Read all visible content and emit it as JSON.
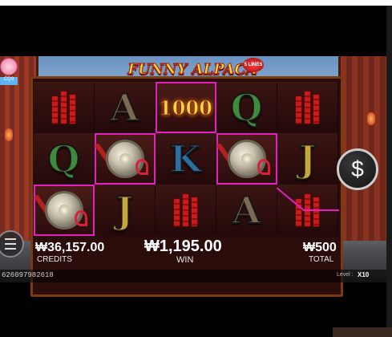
{
  "game": {
    "title": "FUNNY ALPACA",
    "lines_badge": "5 LINES",
    "logo_tag": "CQ9",
    "colors": {
      "win_highlight": "#e21fbf",
      "letter_A": "#7a6a54",
      "letter_Q": "#3f8a3c",
      "letter_K": "#2d6fa0",
      "letter_J": "#c7a63a",
      "bonus": "#ffd24a"
    }
  },
  "reels": {
    "rows": [
      [
        {
          "symbol": "firecrackers",
          "win": false
        },
        {
          "symbol": "A",
          "win": false
        },
        {
          "symbol": "1000",
          "win": true
        },
        {
          "symbol": "Q",
          "win": false
        },
        {
          "symbol": "firecrackers",
          "win": false
        }
      ],
      [
        {
          "symbol": "Q",
          "win": false
        },
        {
          "symbol": "gong",
          "win": true
        },
        {
          "symbol": "K",
          "win": false
        },
        {
          "symbol": "gong",
          "win": true
        },
        {
          "symbol": "J",
          "win": false
        }
      ],
      [
        {
          "symbol": "gong",
          "win": true
        },
        {
          "symbol": "J",
          "win": false
        },
        {
          "symbol": "firecrackers",
          "win": false
        },
        {
          "symbol": "A",
          "win": false
        },
        {
          "symbol": "firecrackers",
          "win": false
        }
      ]
    ]
  },
  "controls": {
    "coin_icon": "$",
    "menu_icon": "hamburger-menu-icon"
  },
  "info": {
    "credits_value": "₩36,157.00",
    "credits_label": "CREDITS",
    "win_value": "₩1,195.00",
    "win_label": "WIN",
    "total_value": "₩500",
    "total_label": "TOTAL"
  },
  "footer": {
    "session_id": "626097982618",
    "level_label": "Level :",
    "level_value": "X10"
  }
}
